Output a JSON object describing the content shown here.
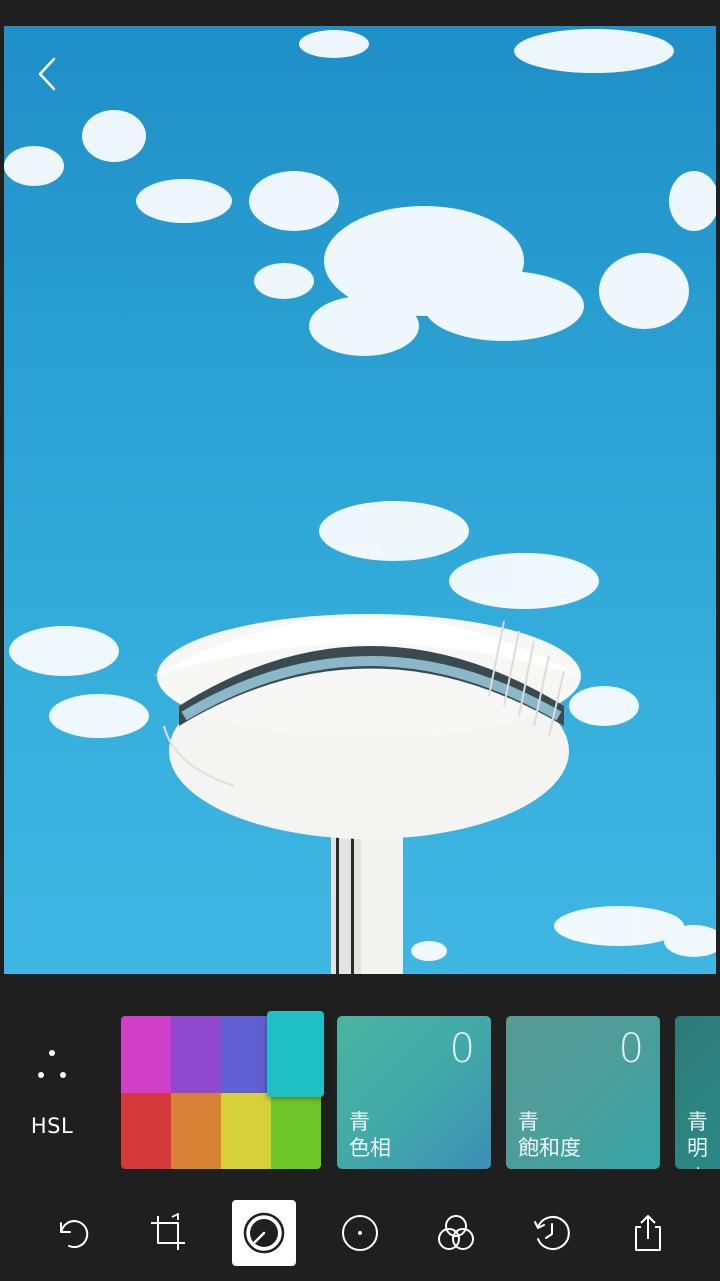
{
  "colors": {
    "background": "#1f1f1f",
    "icon": "#ffffff",
    "swatches": [
      "#cf3fc8",
      "#8f49cf",
      "#6060d2",
      "#1fc0c5",
      "#d5393b",
      "#d88236",
      "#d6d138",
      "#70c72c"
    ]
  },
  "icons": {
    "back": "chevron-left-icon",
    "hsl_mode": "three-dots-icon"
  },
  "hsl": {
    "mode_label": "HSL",
    "selected_color": "cyan",
    "cards": [
      {
        "value": "0",
        "line1": "青",
        "line2": "色相"
      },
      {
        "value": "0",
        "line1": "青",
        "line2": "飽和度"
      },
      {
        "value": "",
        "line1": "青",
        "line2": "明度"
      }
    ]
  },
  "toolbar": {
    "tools": [
      "undo-icon",
      "crop-icon",
      "adjust-dial-icon",
      "circle-icon",
      "overlap-circles-icon",
      "history-icon",
      "share-icon"
    ],
    "active": "adjust-dial-icon"
  }
}
